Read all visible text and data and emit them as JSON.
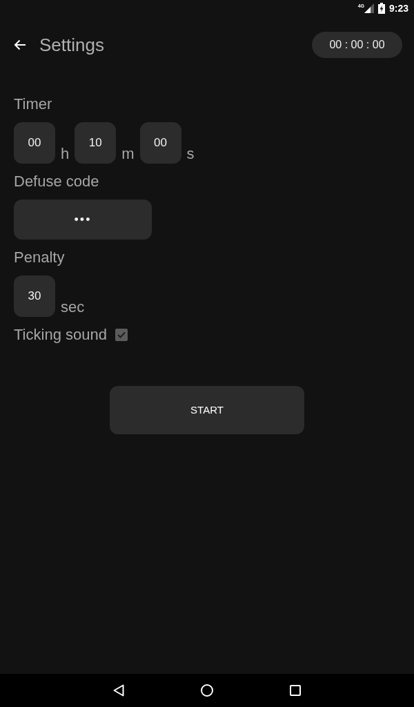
{
  "status_bar": {
    "network": "4G",
    "time": "9:23"
  },
  "toolbar": {
    "title": "Settings",
    "timer_display": "00 : 00 : 00"
  },
  "sections": [
    {
      "kind": "duration",
      "label": "Timer",
      "fields": [
        {
          "value": "00",
          "unit": "h"
        },
        {
          "value": "10",
          "unit": "m"
        },
        {
          "value": "00",
          "unit": "s"
        }
      ]
    },
    {
      "kind": "password",
      "label": "Defuse code",
      "value": "•••"
    },
    {
      "kind": "duration",
      "label": "Penalty",
      "fields": [
        {
          "value": "30",
          "unit": "sec"
        }
      ]
    },
    {
      "kind": "checkbox",
      "label": "Ticking sound",
      "checked": true
    }
  ],
  "start_button": {
    "label": "START"
  }
}
